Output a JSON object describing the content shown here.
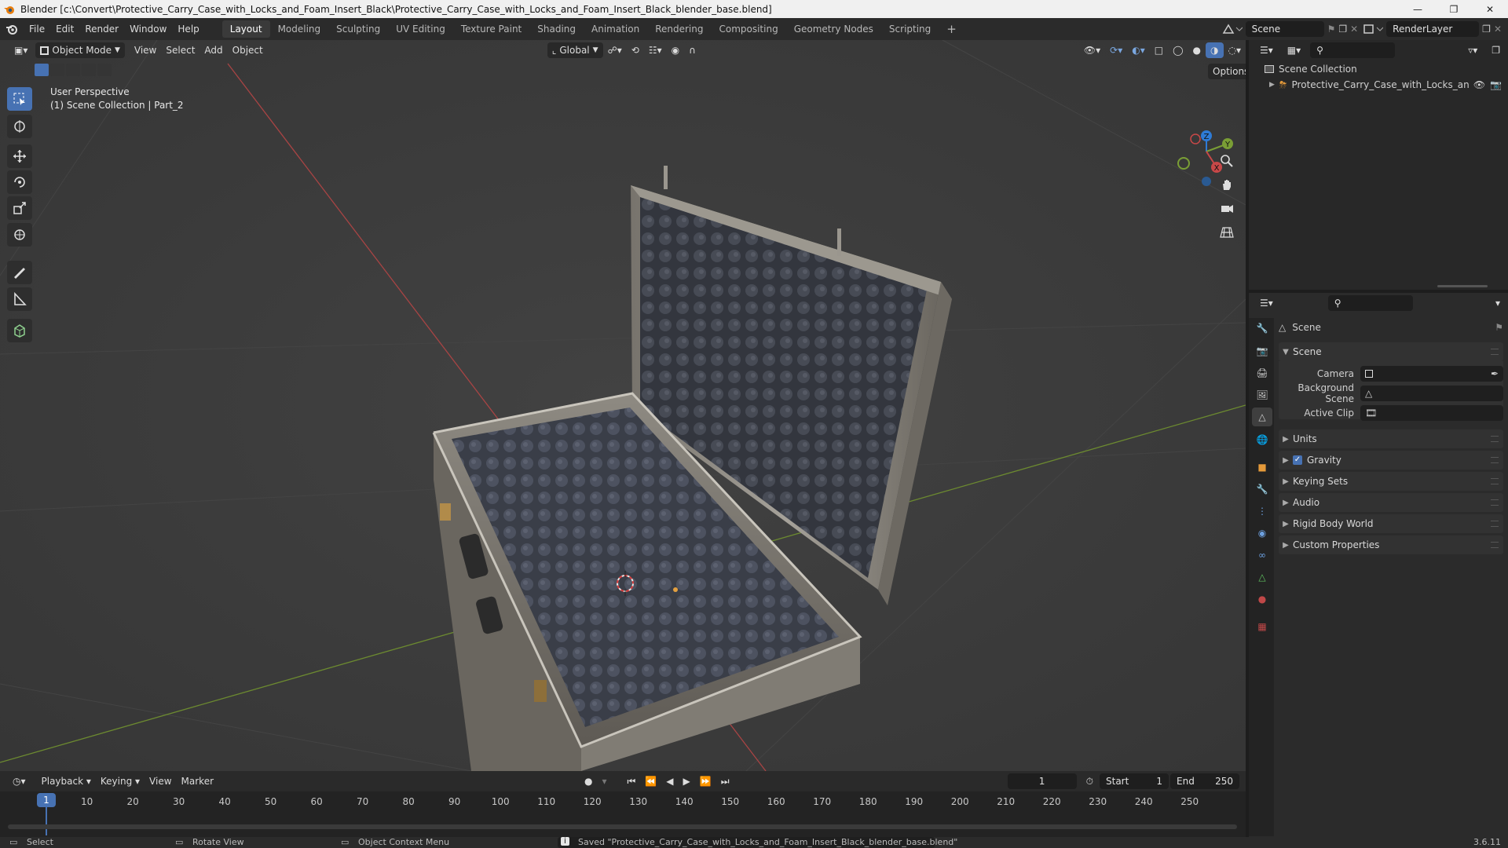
{
  "window": {
    "title": "Blender [c:\\Convert\\Protective_Carry_Case_with_Locks_and_Foam_Insert_Black\\Protective_Carry_Case_with_Locks_and_Foam_Insert_Black_blender_base.blend]"
  },
  "menu": {
    "items": [
      "File",
      "Edit",
      "Render",
      "Window",
      "Help"
    ]
  },
  "workspaces": {
    "tabs": [
      "Layout",
      "Modeling",
      "Sculpting",
      "UV Editing",
      "Texture Paint",
      "Shading",
      "Animation",
      "Rendering",
      "Compositing",
      "Geometry Nodes",
      "Scripting"
    ],
    "add": "+",
    "active": "Layout"
  },
  "scene_selector": {
    "value": "Scene"
  },
  "renderlayer_selector": {
    "value": "RenderLayer"
  },
  "viewport": {
    "mode": "Object Mode",
    "menus": [
      "View",
      "Select",
      "Add",
      "Object"
    ],
    "transform_orientation": "Global",
    "options_label": "Options",
    "overlay_line1": "User Perspective",
    "overlay_line2": "(1) Scene Collection | Part_2",
    "gizmo_axes": {
      "x": "X",
      "y": "Y",
      "z": "Z"
    }
  },
  "outliner": {
    "root": "Scene Collection",
    "items": [
      {
        "label": "Protective_Carry_Case_with_Locks_and"
      }
    ]
  },
  "properties": {
    "header_title": "Scene",
    "panel_title": "Scene",
    "fields": {
      "camera": "Camera",
      "background_scene": "Background Scene",
      "active_clip": "Active Clip"
    },
    "sections": [
      "Units",
      "Gravity",
      "Keying Sets",
      "Audio",
      "Rigid Body World",
      "Custom Properties"
    ],
    "gravity_enabled": true
  },
  "timeline": {
    "menus": [
      "Playback",
      "Keying",
      "View",
      "Marker"
    ],
    "current_frame": "1",
    "start_label": "Start",
    "start": "1",
    "end_label": "End",
    "end": "250",
    "frame_ticks": [
      "1",
      "10",
      "20",
      "30",
      "40",
      "50",
      "60",
      "70",
      "80",
      "90",
      "100",
      "110",
      "120",
      "130",
      "140",
      "150",
      "160",
      "170",
      "180",
      "190",
      "200",
      "210",
      "220",
      "230",
      "240",
      "250"
    ]
  },
  "statusbar": {
    "select": "Select",
    "rotate": "Rotate View",
    "context": "Object Context Menu",
    "message": "Saved \"Protective_Carry_Case_with_Locks_and_Foam_Insert_Black_blender_base.blend\"",
    "version": "3.6.11"
  },
  "colors": {
    "accent": "#4772b3",
    "viewport_bg": "#3c3c3c",
    "axis_x": "#c84848",
    "axis_y": "#7a9e35",
    "axis_z": "#2e7bd6"
  }
}
